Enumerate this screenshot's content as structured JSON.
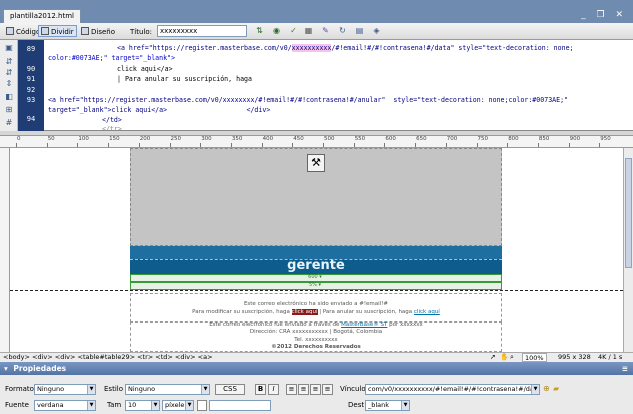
{
  "window": {
    "doc_tab": "plantilla2012.html",
    "window_controls": "_ ❐ ✕"
  },
  "toolbar": {
    "code_label": "Código",
    "split_label": "Dividir",
    "design_label": "Diseño",
    "title_label": "Título:",
    "title_value": "xxxxxxxxx"
  },
  "code": {
    "lines": [
      {
        "num": "89",
        "text": ""
      },
      {
        "num": "90",
        "text": ""
      },
      {
        "num": "91",
        "text": ""
      },
      {
        "num": "92",
        "text": ""
      },
      {
        "num": "93",
        "text": ""
      },
      {
        "num": "94",
        "text": ""
      }
    ],
    "line89a_pre": "<a href=\"https://register.masterbase.com/v0/",
    "line89a_hl": "xxxxxxxxxx",
    "line89a_post": "/#!email!#/#!contrasena!#/data\" style=\"text-decoration: none;",
    "line89b": "color:#0073AE;\" target=\"_blank\">",
    "line90": "click aqui</a>",
    "line91": "| Para anular su suscripción, haga",
    "line93a": "<a href=\"https://register.masterbase.com/v0/xxxxxxxx/#!email!#/#!contrasena!#/anular\"  style=\"text-decoration: none;color:#0073AE;\"",
    "line93b": "target=\"_blank\">click aqui</a>                    </div>",
    "line94": "</td>",
    "line95": "</tr>"
  },
  "ruler": {
    "marks": [
      "0",
      "50",
      "100",
      "150",
      "200",
      "250",
      "300",
      "350",
      "400",
      "450",
      "500",
      "550",
      "600",
      "650",
      "700",
      "750",
      "800",
      "850",
      "900",
      "950"
    ]
  },
  "design": {
    "banner_text": "gerente",
    "width_label_1": "600 ▾",
    "width_label_2": "5% ▾",
    "email_line1": "Este correo electrónico ha sido enviado a #!email!#",
    "email_line2_pre": "Para modificar su suscripción, haga ",
    "email_line2_link1": "click aquí",
    "email_line2_mid": " | Para anular su suscripción, haga ",
    "email_line2_link2": "click aquí",
    "footer_line1_pre": "Este correo electrónico fue enviado a través de ",
    "footer_line1_link": "MasterBase® ST",
    "footer_line1_post": " por xxxxxxx",
    "footer_line2": "Dirección: CRA xxxxxxxxxxx | Bogotá, Colombia",
    "footer_line3": "Tel. xxxxxxxxxx",
    "footer_line4": "©2012 Derechos Reservados"
  },
  "status": {
    "tag_path": "<body> <div> <div> <table#table29> <tr> <td> <div> <a>",
    "zoom": "100%",
    "size": "995 x 328",
    "file_info": "4K / 1 s"
  },
  "properties": {
    "header": "Propiedades",
    "formato_label": "Formato",
    "formato_value": "Ninguno",
    "estilo_label": "Estilo",
    "estilo_value": "Ninguno",
    "css_label": "CSS",
    "bold": "B",
    "italic": "I",
    "vinculo_label": "Vínculo",
    "vinculo_value": "com/v0/xxxxxxxxxx/#!email!#/#!contrasena!#/data",
    "fuente_label": "Fuente",
    "fuente_value": "verdana",
    "tam_label": "Tam",
    "tam_value": "10",
    "unit_value": "píxele",
    "dest_label": "Dest",
    "dest_value": "_blank"
  },
  "colors": {
    "banner": "#1e6fa0",
    "banner_dark": "#0d5c8c",
    "gray_header": "#c4c4c4",
    "gutter": "#1f3c74",
    "link": "#0073AE"
  }
}
